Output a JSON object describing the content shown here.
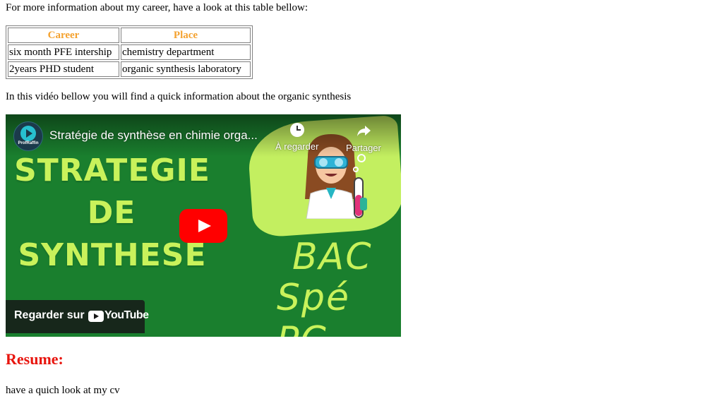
{
  "intro_text": "For more information about my career, have a look at this table bellow:",
  "career_table": {
    "headers": [
      "Career",
      "Place"
    ],
    "rows": [
      [
        "six month PFE intership",
        "chemistry department"
      ],
      [
        "2years PHD student",
        "organic synthesis laboratory"
      ]
    ]
  },
  "video_intro": "In this vidéo bellow you will find a quick information about the organic synthesis",
  "video": {
    "channel_name": "ProfRaffin",
    "title": "Stratégie de synthèse en chimie orga...",
    "actions": [
      {
        "label": "À regarder",
        "icon": "clock-icon"
      },
      {
        "label": "Partager",
        "icon": "share-icon"
      }
    ],
    "thumbnail_lines": [
      "STRATEGIE",
      "DE",
      "SYNTHESE"
    ],
    "thumbnail_side": [
      "BAC",
      "Spé PC"
    ],
    "watch_on_label": "Regarder sur",
    "youtube_word": "YouTube"
  },
  "resume_heading": "Resume:",
  "cv_text": "have a quich look at my cv",
  "colors": {
    "table_header": "#f4a230",
    "resume_heading": "#e8150e",
    "thumbnail_bg": "#1a7f2e",
    "thumbnail_text": "#c9f25b",
    "play_button": "#ff0000"
  }
}
